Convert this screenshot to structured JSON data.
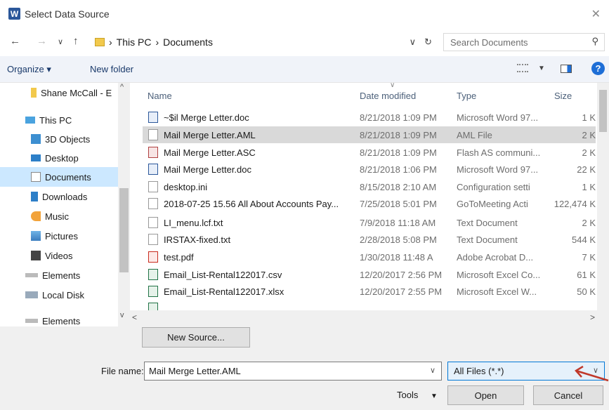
{
  "window": {
    "title": "Select Data Source",
    "app_icon": "W"
  },
  "address": {
    "crumbs": [
      "This PC",
      "Documents"
    ],
    "search_placeholder": "Search Documents"
  },
  "toolbar": {
    "organize": "Organize ▾",
    "new_folder": "New folder"
  },
  "nav": {
    "items": [
      {
        "label": "Shane McCall - E",
        "icon": "folder-icon"
      },
      {
        "label": "This PC",
        "icon": "computer-icon"
      },
      {
        "label": "3D Objects",
        "icon": "3d-objects-icon"
      },
      {
        "label": "Desktop",
        "icon": "desktop-icon"
      },
      {
        "label": "Documents",
        "icon": "documents-icon",
        "selected": true
      },
      {
        "label": "Downloads",
        "icon": "downloads-icon"
      },
      {
        "label": "Music",
        "icon": "music-icon"
      },
      {
        "label": "Pictures",
        "icon": "pictures-icon"
      },
      {
        "label": "Videos",
        "icon": "videos-icon"
      },
      {
        "label": "Elements",
        "icon": "drive-icon"
      },
      {
        "label": "Local Disk",
        "icon": "drive-icon"
      },
      {
        "label": "Elements",
        "icon": "drive-icon"
      }
    ]
  },
  "columns": {
    "name": "Name",
    "date": "Date modified",
    "type": "Type",
    "size": "Size"
  },
  "files": [
    {
      "name": "~$il Merge Letter.doc",
      "date": "8/21/2018 1:09 PM",
      "type": "Microsoft Word 97...",
      "size": "1 K",
      "kind": "word"
    },
    {
      "name": "Mail Merge Letter.AML",
      "date": "8/21/2018 1:09 PM",
      "type": "AML File",
      "size": "2 K",
      "kind": "plain",
      "selected": true
    },
    {
      "name": "Mail Merge Letter.ASC",
      "date": "8/21/2018 1:09 PM",
      "type": "Flash AS communi...",
      "size": "2 K",
      "kind": "flash"
    },
    {
      "name": "Mail Merge Letter.doc",
      "date": "8/21/2018 1:06 PM",
      "type": "Microsoft Word 97...",
      "size": "22 K",
      "kind": "word"
    },
    {
      "name": "desktop.ini",
      "date": "8/15/2018 2:10 AM",
      "type": "Configuration setti",
      "size": "1 K",
      "kind": "plain"
    },
    {
      "name": "2018-07-25 15.56 All About Accounts Pay...",
      "date": "7/25/2018 5:01 PM",
      "type": "GoToMeeting Acti",
      "size": "122,474 K",
      "kind": "plain"
    },
    {
      "name": "LI_menu.lcf.txt",
      "date": "7/9/2018 11:18 AM",
      "type": "Text Document",
      "size": "2 K",
      "kind": "plain"
    },
    {
      "name": "IRSTAX-fixed.txt",
      "date": "2/28/2018 5:08 PM",
      "type": "Text Document",
      "size": "544 K",
      "kind": "plain"
    },
    {
      "name": "test.pdf",
      "date": "1/30/2018 11:48 A",
      "type": "Adobe Acrobat D...",
      "size": "7 K",
      "kind": "pdf"
    },
    {
      "name": "Email_List-Rental122017.csv",
      "date": "12/20/2017 2:56 PM",
      "type": "Microsoft Excel Co...",
      "size": "61 K",
      "kind": "excel"
    },
    {
      "name": "Email_List-Rental122017.xlsx",
      "date": "12/20/2017 2:55 PM",
      "type": "Microsoft Excel W...",
      "size": "50 K",
      "kind": "excel"
    }
  ],
  "bottom": {
    "new_source": "New Source...",
    "file_name_label": "File name:",
    "file_name_value": "Mail Merge Letter.AML",
    "filter_value": "All Files (*.*)",
    "tools": "Tools",
    "open": "Open",
    "cancel": "Cancel"
  }
}
